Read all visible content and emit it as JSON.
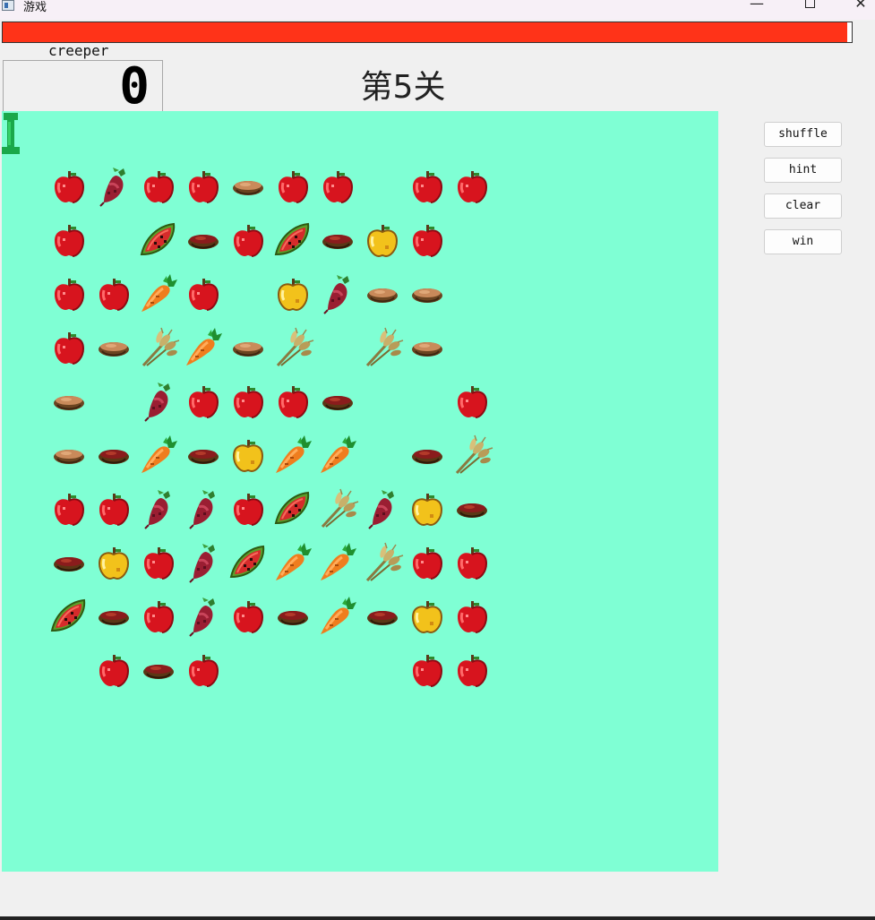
{
  "window": {
    "title": "游戏",
    "minimize_glyph": "—",
    "close_glyph": "✕"
  },
  "timer": {
    "fill_fraction": 0.995,
    "color": "#ff3318"
  },
  "score": {
    "label": "creeper",
    "value": "0"
  },
  "level": {
    "title": "第5关"
  },
  "board": {
    "background": "#7fffd4",
    "rows": [
      [
        "apple",
        "beetroot",
        "apple",
        "apple",
        "stew",
        "apple",
        "apple",
        "",
        "apple",
        "apple"
      ],
      [
        "apple",
        "",
        "melon",
        "bowl",
        "apple",
        "melon",
        "bowl",
        "golden",
        "apple",
        ""
      ],
      [
        "apple",
        "apple",
        "carrot",
        "apple",
        "",
        "golden",
        "beetroot",
        "stew",
        "stew",
        ""
      ],
      [
        "apple",
        "stew",
        "wheat",
        "carrot",
        "stew",
        "wheat",
        "",
        "wheat",
        "stew",
        ""
      ],
      [
        "stew",
        "",
        "beetroot",
        "apple",
        "apple",
        "apple",
        "bowl",
        "",
        "",
        "apple"
      ],
      [
        "stew",
        "bowl",
        "carrot",
        "bowl",
        "golden",
        "carrot",
        "carrot",
        "",
        "bowl",
        "wheat"
      ],
      [
        "apple",
        "apple",
        "beetroot",
        "beetroot",
        "apple",
        "melon",
        "wheat",
        "beetroot",
        "golden",
        "bowl"
      ],
      [
        "bowl",
        "golden",
        "apple",
        "beetroot",
        "melon",
        "carrot",
        "carrot",
        "wheat",
        "apple",
        "apple"
      ],
      [
        "melon",
        "bowl",
        "apple",
        "beetroot",
        "apple",
        "bowl",
        "carrot",
        "bowl",
        "golden",
        "apple"
      ],
      [
        "",
        "apple",
        "bowl",
        "apple",
        "",
        "",
        "",
        "",
        "apple",
        "apple"
      ]
    ]
  },
  "buttons": {
    "shuffle": "shuffle",
    "hint": "hint",
    "clear": "clear",
    "win": "win"
  }
}
